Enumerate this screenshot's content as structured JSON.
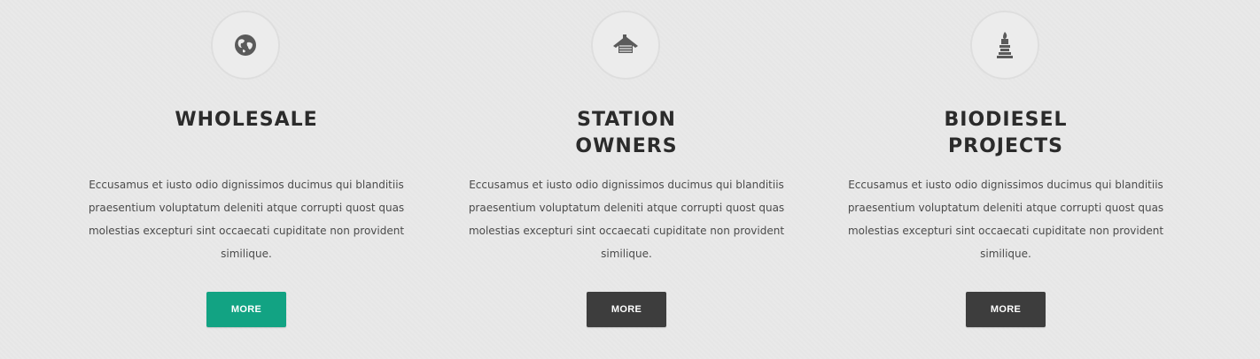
{
  "features": [
    {
      "icon": "globe-icon",
      "title_lines": [
        "WHOLESALE",
        ""
      ],
      "description": "Eccusamus et iusto odio dignissimos ducimus qui blanditiis praesentium voluptatum deleniti atque corrupti quost quas molestias excepturi sint occaecati cupiditate non provident similique.",
      "button_label": "MORE",
      "button_color": "#12a383"
    },
    {
      "icon": "gas-station-roof-icon",
      "title_lines": [
        "STATION",
        "OWNERS"
      ],
      "description": "Eccusamus et iusto odio dignissimos ducimus qui blanditiis praesentium voluptatum deleniti atque corrupti quost quas molestias excepturi sint occaecati cupiditate non provident similique.",
      "button_label": "MORE",
      "button_color": "#3d3d3d"
    },
    {
      "icon": "biodiesel-plant-icon",
      "title_lines": [
        "BIODIESEL",
        "PROJECTS"
      ],
      "description": "Eccusamus et iusto odio dignissimos ducimus qui blanditiis praesentium voluptatum deleniti atque corrupti quost quas molestias excepturi sint occaecati cupiditate non provident similique.",
      "button_label": "MORE",
      "button_color": "#3d3d3d"
    }
  ]
}
